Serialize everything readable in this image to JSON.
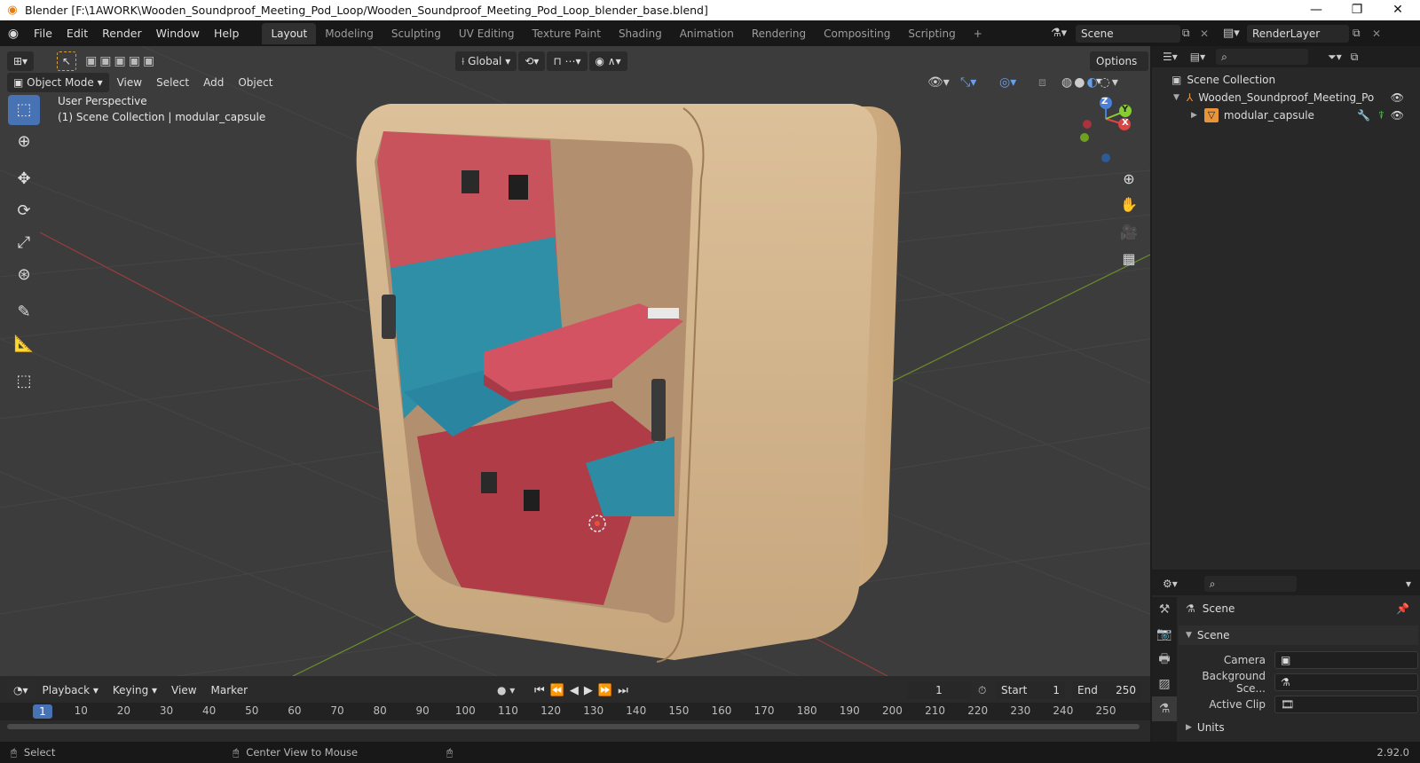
{
  "window": {
    "title": "Blender [F:\\1AWORK\\Wooden_Soundproof_Meeting_Pod_Loop/Wooden_Soundproof_Meeting_Pod_Loop_blender_base.blend]",
    "min": "—",
    "max": "❐",
    "close": "✕"
  },
  "menus": [
    "File",
    "Edit",
    "Render",
    "Window",
    "Help"
  ],
  "workspaces": [
    "Layout",
    "Modeling",
    "Sculpting",
    "UV Editing",
    "Texture Paint",
    "Shading",
    "Animation",
    "Rendering",
    "Compositing",
    "Scripting",
    "+"
  ],
  "scene_field": "Scene",
  "renderlayer_field": "RenderLayer",
  "viewport": {
    "transform_orientation": "Global",
    "options": "Options",
    "mode": "Object Mode",
    "menus": [
      "View",
      "Select",
      "Add",
      "Object"
    ],
    "perspective_label": "User Perspective",
    "collection_label": "(1) Scene Collection | modular_capsule",
    "gizmo": {
      "z": "Z",
      "y": "Y",
      "x": "X"
    }
  },
  "outliner": {
    "root": "Scene Collection",
    "items": [
      {
        "label": "Wooden_Soundproof_Meeting_Po",
        "icon": "armature-icon"
      },
      {
        "label": "modular_capsule",
        "icon": "mesh-icon"
      }
    ]
  },
  "properties": {
    "header": "Scene",
    "panel": "Scene",
    "camera_label": "Camera",
    "background_label": "Background Sce...",
    "clip_label": "Active Clip",
    "units_label": "Units"
  },
  "timeline": {
    "menus": [
      "Playback",
      "Keying",
      "View",
      "Marker"
    ],
    "current_frame": "1",
    "start_label": "Start",
    "start": "1",
    "end_label": "End",
    "end": "250",
    "ticks": [
      "1",
      "10",
      "20",
      "30",
      "40",
      "50",
      "60",
      "70",
      "80",
      "90",
      "100",
      "110",
      "120",
      "130",
      "140",
      "150",
      "160",
      "170",
      "180",
      "190",
      "200",
      "210",
      "220",
      "230",
      "240",
      "250"
    ]
  },
  "status": {
    "select": "Select",
    "center": "Center View to Mouse",
    "version": "2.92.0"
  }
}
